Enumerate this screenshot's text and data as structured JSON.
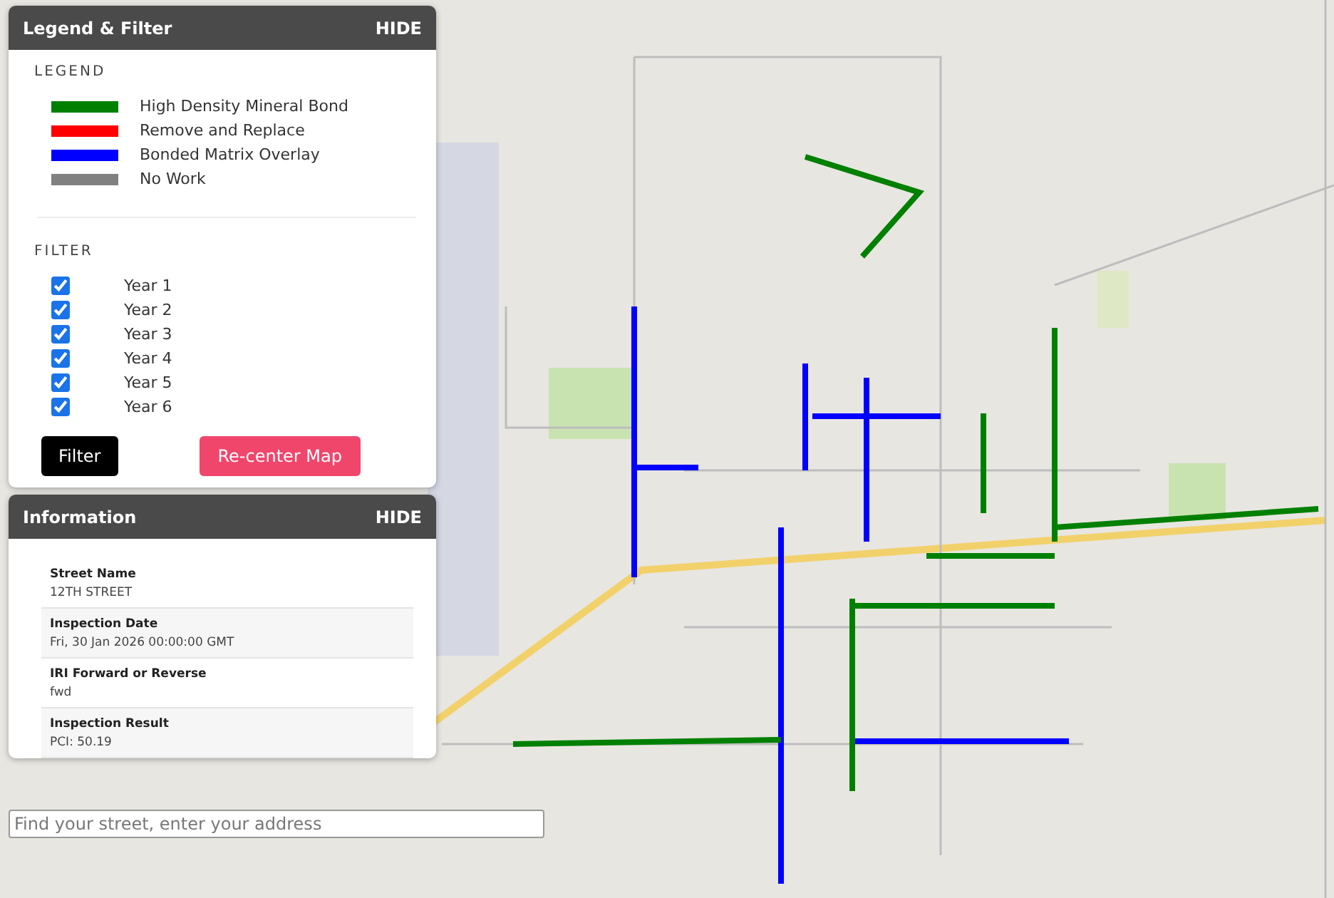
{
  "legend_panel": {
    "title": "Legend & Filter",
    "hide_label": "HIDE",
    "legend_heading": "LEGEND",
    "legend_items": [
      {
        "label": "High Density Mineral Bond",
        "color": "#008000"
      },
      {
        "label": "Remove and Replace",
        "color": "#ff0000"
      },
      {
        "label": "Bonded Matrix Overlay",
        "color": "#0000ff"
      },
      {
        "label": "No Work",
        "color": "#808080"
      }
    ],
    "filter_heading": "FILTER",
    "filters": [
      {
        "label": "Year 1",
        "checked": true
      },
      {
        "label": "Year 2",
        "checked": true
      },
      {
        "label": "Year 3",
        "checked": true
      },
      {
        "label": "Year 4",
        "checked": true
      },
      {
        "label": "Year 5",
        "checked": true
      },
      {
        "label": "Year 6",
        "checked": true
      }
    ],
    "filter_button": "Filter",
    "recenter_button": "Re-center Map"
  },
  "info_panel": {
    "title": "Information",
    "hide_label": "HIDE",
    "fields": [
      {
        "label": "Street Name",
        "value": "12TH STREET"
      },
      {
        "label": "Inspection Date",
        "value": "Fri, 30 Jan 2026 00:00:00 GMT"
      },
      {
        "label": "IRI Forward or Reverse",
        "value": "fwd"
      },
      {
        "label": "Inspection Result",
        "value": "PCI: 50.19"
      }
    ]
  },
  "search": {
    "placeholder": "Find your street, enter your address"
  }
}
